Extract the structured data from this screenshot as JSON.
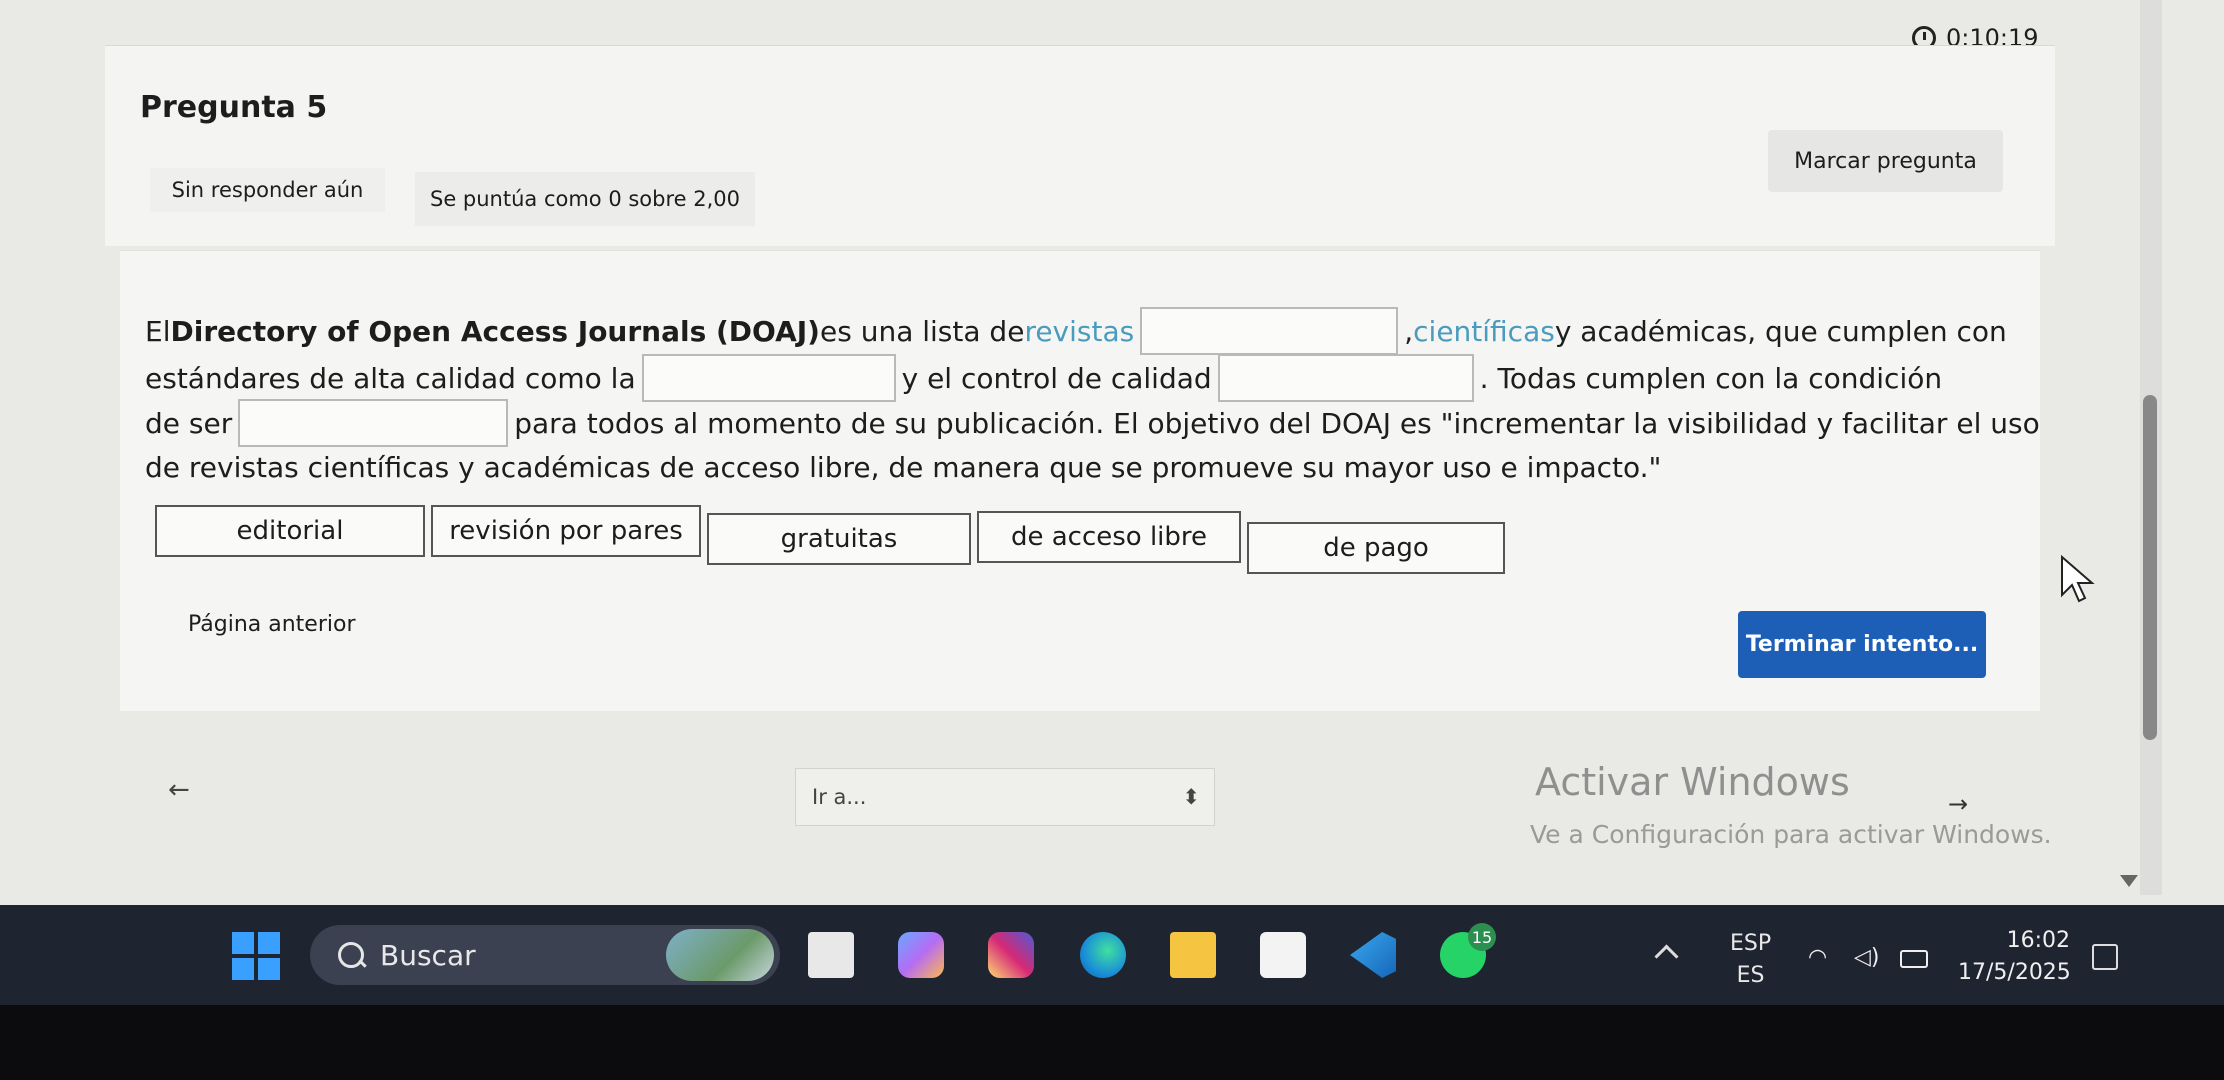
{
  "timer": {
    "value": "0:10:19"
  },
  "question": {
    "title": "Pregunta 5",
    "status": "Sin responder aún",
    "grade": "Se puntúa como 0 sobre 2,00",
    "flag_label": "Marcar pregunta",
    "text": {
      "l1a": "El ",
      "l1b": "Directory of Open Access Journals (DOAJ)",
      "l1c": " es una lista de ",
      "l1d": "revistas",
      "l1e": ", ",
      "l1f": "científicas",
      "l1g": " y académicas, que cumplen con",
      "l2a": "estándares de alta calidad como la",
      "l2b": "y el control de calidad",
      "l2c": ". Todas cumplen con la condición",
      "l3a": "de ser",
      "l3b": "para todos al momento de su publicación. El objetivo del DOAJ es \"incrementar la visibilidad y facilitar el uso",
      "l4": "de revistas científicas y académicas de acceso libre, de manera que se promueve su mayor uso e impacto.\""
    },
    "options": [
      "editorial",
      "revisión por pares",
      "gratuitas",
      "de acceso libre",
      "de pago"
    ]
  },
  "nav": {
    "prev_label": "Página anterior",
    "finish_label": "Terminar intento...",
    "left_arrow": "←",
    "right_arrow": "→",
    "goto_label": "Ir a...",
    "goto_caret": "⬍"
  },
  "watermark": {
    "title": "Activar Windows",
    "subtitle": "Ve a Configuración para activar Windows."
  },
  "taskbar": {
    "search_label": "Buscar",
    "whatsapp_badge": "15",
    "lang_top": "ESP",
    "lang_bottom": "ES",
    "time": "16:02",
    "date": "17/5/2025",
    "icons": [
      "windows-start-icon",
      "file-explorer-icon",
      "copilot-icon",
      "instagram-icon",
      "edge-icon",
      "folder-icon",
      "store-icon",
      "vscode-icon",
      "whatsapp-icon"
    ],
    "colors": {
      "taskbar": "#1f2431",
      "accent": "#1d5fb7"
    }
  }
}
